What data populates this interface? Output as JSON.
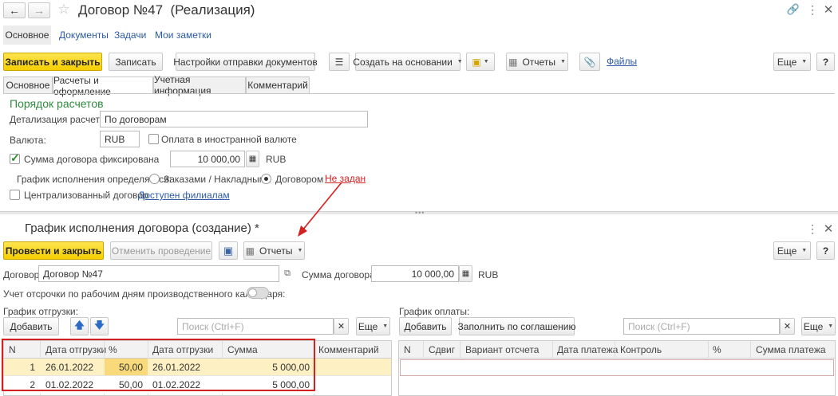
{
  "window": {
    "title": "Договор №47  (Реализация)"
  },
  "nav": {
    "main": "Основное",
    "docs": "Документы",
    "tasks": "Задачи",
    "notes": "Мои заметки"
  },
  "toolbar": {
    "save_close": "Записать и закрыть",
    "save": "Записать",
    "send_settings": "Настройки отправки документов",
    "create_based": "Создать на основании",
    "reports": "Отчеты",
    "files": "Файлы",
    "more": "Еще",
    "help": "?"
  },
  "tabs": [
    "Основное",
    "Расчеты и оформление",
    "Учетная информация",
    "Комментарий"
  ],
  "payment": {
    "section_title": "Порядок расчетов",
    "detail_label": "Детализация расчетов:",
    "detail_value": "По договорам",
    "currency_label": "Валюта:",
    "currency_value": "RUB",
    "foreign_label": "Оплата в иностранной валюте",
    "fixed_label": "Сумма договора фиксирована",
    "fixed_amount": "10 000,00",
    "fixed_currency": "RUB",
    "schedule_label": "График исполнения определяется:",
    "opt_orders": "Заказами / Накладными",
    "opt_contract": "Договором",
    "not_set": "Не задан",
    "central_label": "Централизованный договор",
    "branches_link": "Доступен филиалам"
  },
  "schedule_form": {
    "title": "График исполнения договора (создание) *",
    "post_close": "Провести и закрыть",
    "cancel_post": "Отменить проведение",
    "reports": "Отчеты",
    "more": "Еще",
    "help": "?",
    "contract_label": "Договор:",
    "contract_value": "Договор №47",
    "sum_label": "Сумма договора:",
    "sum_value": "10 000,00",
    "sum_currency": "RUB",
    "workdays_label": "Учет отсрочки по рабочим дням производственного календаря:"
  },
  "shipment": {
    "title": "График отгрузки:",
    "add": "Добавить",
    "search_placeholder": "Поиск (Ctrl+F)",
    "more": "Еще",
    "columns": [
      "N",
      "Дата отгрузки",
      "%",
      "Дата отгрузки",
      "Сумма",
      "Комментарий"
    ],
    "rows": [
      {
        "n": "1",
        "date1": "26.01.2022",
        "pct": "50,00",
        "date2": "26.01.2022",
        "sum": "5 000,00"
      },
      {
        "n": "2",
        "date1": "01.02.2022",
        "pct": "50,00",
        "date2": "01.02.2022",
        "sum": "5 000,00"
      }
    ]
  },
  "payments": {
    "title": "График оплаты:",
    "add": "Добавить",
    "fill": "Заполнить по соглашению",
    "search_placeholder": "Поиск (Ctrl+F)",
    "more": "Еще",
    "columns": [
      "N",
      "Сдвиг",
      "Вариант отсчета",
      "Дата платежа",
      "Контроль",
      "%",
      "Сумма платежа"
    ]
  },
  "colors": {
    "accent": "#f5cf00",
    "section_title": "#2e8b3e",
    "highlight_row": "#fdf0c2",
    "red": "#d42020",
    "link": "#2b5ba8"
  }
}
